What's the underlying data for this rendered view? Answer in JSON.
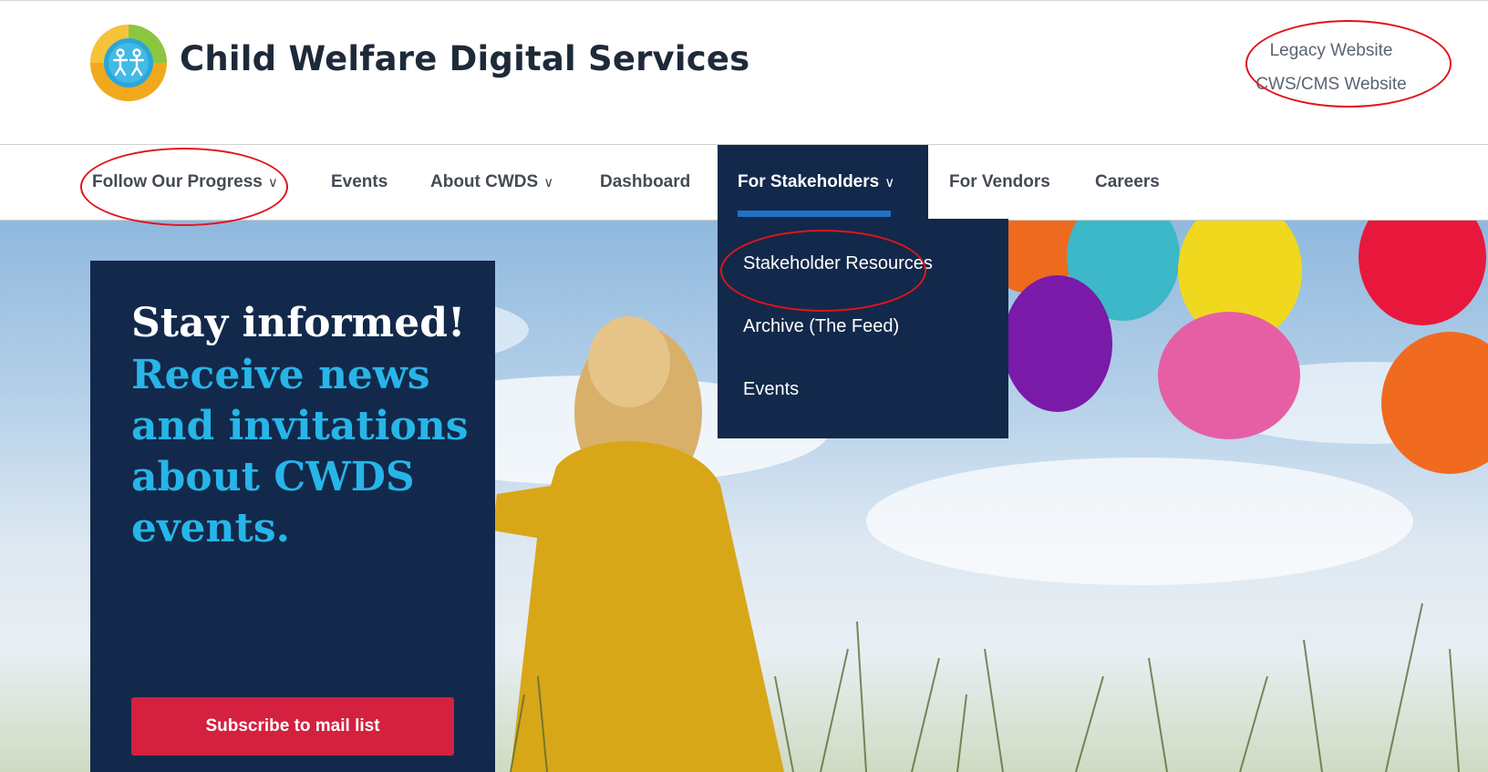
{
  "header": {
    "site_title": "Child Welfare Digital Services",
    "utility_links": [
      "Legacy Website",
      "CWS/CMS Website"
    ]
  },
  "nav": {
    "items": [
      {
        "label": "Follow Our Progress",
        "has_dropdown": true
      },
      {
        "label": "Events",
        "has_dropdown": false
      },
      {
        "label": "About CWDS",
        "has_dropdown": true
      },
      {
        "label": "Dashboard",
        "has_dropdown": false
      },
      {
        "label": "For Stakeholders",
        "has_dropdown": true,
        "active": true
      },
      {
        "label": "For Vendors",
        "has_dropdown": false
      },
      {
        "label": "Careers",
        "has_dropdown": false
      }
    ],
    "dropdown": {
      "items": [
        "Stakeholder Resources",
        "Archive (The Feed)",
        "Events"
      ]
    }
  },
  "promo": {
    "heading": "Stay informed!",
    "subheading": "Receive news and invitations about CWDS events.",
    "button_label": "Subscribe to mail list"
  },
  "icons": {
    "logo": "cwds-logo-icon",
    "dropdown_chevron": "chevron-down-icon"
  },
  "colors": {
    "navy": "#12294b",
    "accent_blue": "#27b5e8",
    "nav_underline": "#1f72c4",
    "subscribe_red": "#d3213f",
    "annotation_red": "#e0141b"
  }
}
